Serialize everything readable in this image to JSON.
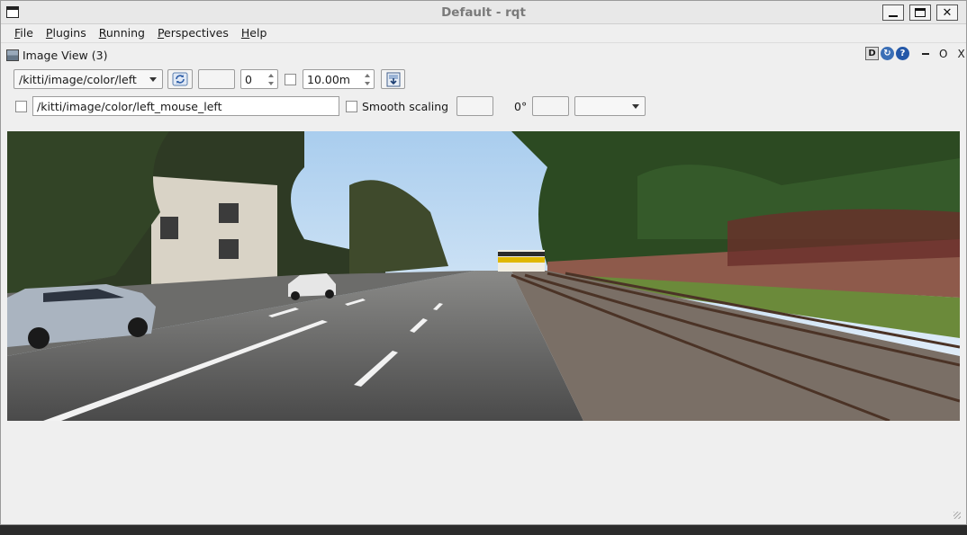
{
  "window": {
    "title": "Default - rqt"
  },
  "menu": {
    "items": [
      {
        "key": "F",
        "rest": "ile"
      },
      {
        "key": "P",
        "rest": "lugins"
      },
      {
        "key": "R",
        "rest": "unning"
      },
      {
        "key": "P",
        "rest": "erspectives"
      },
      {
        "key": "H",
        "rest": "elp"
      }
    ]
  },
  "plugin": {
    "title": "Image View (3)",
    "header_buttons": {
      "d": "D",
      "o": "O",
      "x": "X"
    }
  },
  "toolbar": {
    "topic": "/kitti/image/color/left",
    "spin_value": "0",
    "duration": "10.00m",
    "mouse_topic": "/kitti/image/color/left_mouse_left",
    "smooth_scaling_label": "Smooth scaling",
    "rotation": "0°"
  },
  "colors": {
    "sky": "#cfe4f5",
    "road": "#5a5a5a",
    "grass": "#6e8a3c",
    "wall": "#8a5246"
  }
}
